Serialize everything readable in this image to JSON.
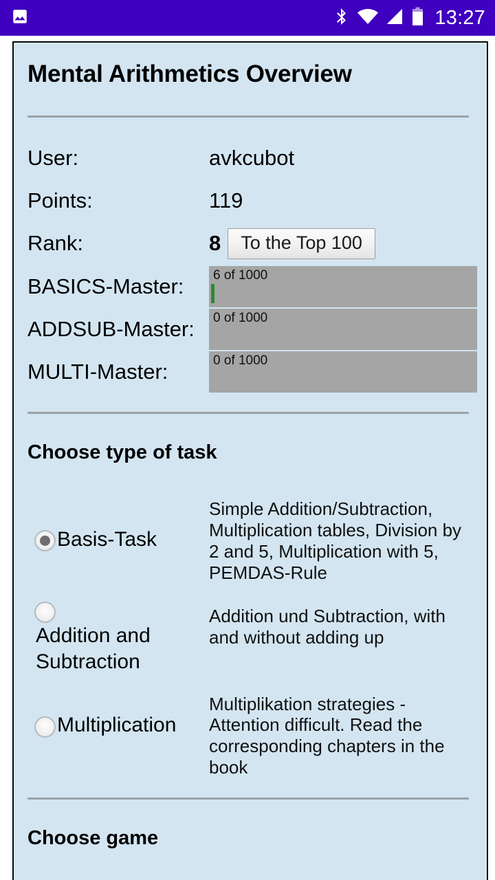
{
  "status_bar": {
    "time": "13:27",
    "icons": [
      "image-icon",
      "bluetooth-icon",
      "wifi-icon",
      "cellular-signal-icon",
      "battery-icon"
    ],
    "background_color": "#3f00bf",
    "foreground_color": "#ffffff"
  },
  "card": {
    "background_color": "#d3e5f1",
    "title": "Mental Arithmetics Overview"
  },
  "info": {
    "user_label": "User:",
    "user_value": "avkcubot",
    "points_label": "Points:",
    "points_value": "119",
    "rank_label": "Rank:",
    "rank_value": "8",
    "top100_button": "To the Top 100"
  },
  "progress": [
    {
      "label": "BASICS-Master:",
      "text": "6 of 1000",
      "current": 6,
      "total": 1000,
      "fill_color": "#2f8a2f",
      "track_color": "#a5a5a5"
    },
    {
      "label": "ADDSUB-Master:",
      "text": "0 of 1000",
      "current": 0,
      "total": 1000,
      "fill_color": "#2f8a2f",
      "track_color": "#a5a5a5"
    },
    {
      "label": "MULTI-Master:",
      "text": "0 of 1000",
      "current": 0,
      "total": 1000,
      "fill_color": "#2f8a2f",
      "track_color": "#a5a5a5"
    }
  ],
  "task_section": {
    "heading": "Choose type of task",
    "options": [
      {
        "label": "Basis-Task",
        "description": "Simple Addition/Subtraction, Multiplication tables, Division by 2 and 5, Multiplication with 5, PEMDAS-Rule",
        "selected": true
      },
      {
        "label": "Addition and Subtraction",
        "description": "Addition und Subtraction, with and without adding up",
        "selected": false
      },
      {
        "label": "Multiplication",
        "description": "Multiplikation strategies - Attention difficult. Read the corresponding chapters in the book",
        "selected": false
      }
    ]
  },
  "game_section": {
    "heading": "Choose game"
  }
}
